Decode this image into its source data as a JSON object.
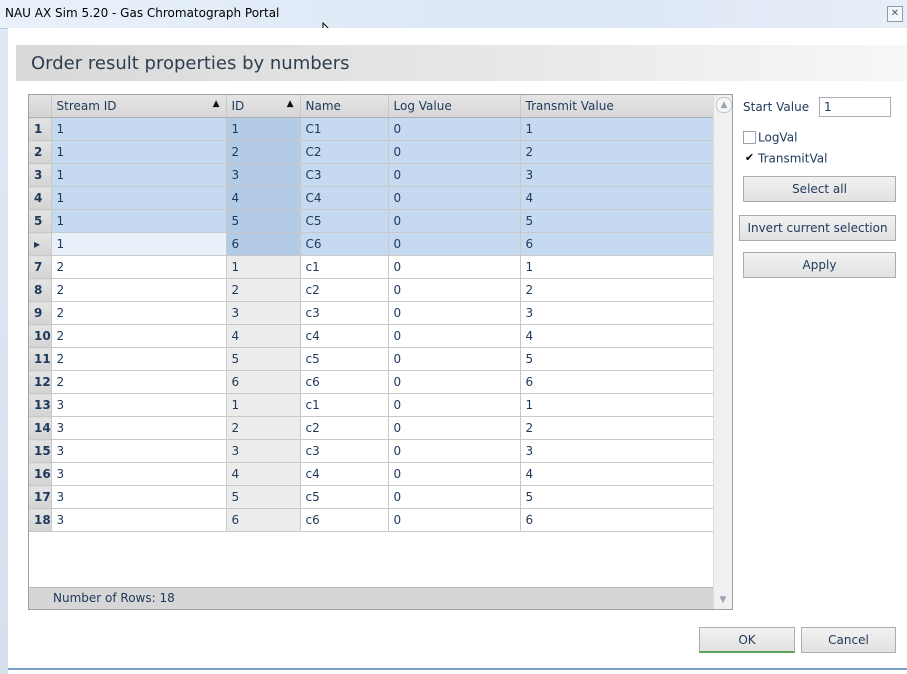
{
  "window": {
    "title": "NAU AX Sim 5.20 - Gas Chromatograph Portal",
    "close_glyph": "✕"
  },
  "dialog": {
    "heading": "Order result properties by numbers"
  },
  "grid": {
    "columns": [
      "Stream ID",
      "ID",
      "Name",
      "Log Value",
      "Transmit Value"
    ],
    "sort_glyph": "▲",
    "current_row_glyph": "▸",
    "rows": [
      {
        "num": "1",
        "stream": "1",
        "id": "1",
        "name": "C1",
        "log": "0",
        "transmit": "1",
        "selected": true
      },
      {
        "num": "2",
        "stream": "1",
        "id": "2",
        "name": "C2",
        "log": "0",
        "transmit": "2",
        "selected": true
      },
      {
        "num": "3",
        "stream": "1",
        "id": "3",
        "name": "C3",
        "log": "0",
        "transmit": "3",
        "selected": true
      },
      {
        "num": "4",
        "stream": "1",
        "id": "4",
        "name": "C4",
        "log": "0",
        "transmit": "4",
        "selected": true
      },
      {
        "num": "5",
        "stream": "1",
        "id": "5",
        "name": "C5",
        "log": "0",
        "transmit": "5",
        "selected": true
      },
      {
        "num": "",
        "stream": "1",
        "id": "6",
        "name": "C6",
        "log": "0",
        "transmit": "6",
        "selected": true,
        "current": true
      },
      {
        "num": "7",
        "stream": "2",
        "id": "1",
        "name": "c1",
        "log": "0",
        "transmit": "1"
      },
      {
        "num": "8",
        "stream": "2",
        "id": "2",
        "name": "c2",
        "log": "0",
        "transmit": "2"
      },
      {
        "num": "9",
        "stream": "2",
        "id": "3",
        "name": "c3",
        "log": "0",
        "transmit": "3"
      },
      {
        "num": "10",
        "stream": "2",
        "id": "4",
        "name": "c4",
        "log": "0",
        "transmit": "4"
      },
      {
        "num": "11",
        "stream": "2",
        "id": "5",
        "name": "c5",
        "log": "0",
        "transmit": "5"
      },
      {
        "num": "12",
        "stream": "2",
        "id": "6",
        "name": "c6",
        "log": "0",
        "transmit": "6"
      },
      {
        "num": "13",
        "stream": "3",
        "id": "1",
        "name": "c1",
        "log": "0",
        "transmit": "1"
      },
      {
        "num": "14",
        "stream": "3",
        "id": "2",
        "name": "c2",
        "log": "0",
        "transmit": "2"
      },
      {
        "num": "15",
        "stream": "3",
        "id": "3",
        "name": "c3",
        "log": "0",
        "transmit": "3"
      },
      {
        "num": "16",
        "stream": "3",
        "id": "4",
        "name": "c4",
        "log": "0",
        "transmit": "4"
      },
      {
        "num": "17",
        "stream": "3",
        "id": "5",
        "name": "c5",
        "log": "0",
        "transmit": "5"
      },
      {
        "num": "18",
        "stream": "3",
        "id": "6",
        "name": "c6",
        "log": "0",
        "transmit": "6"
      }
    ],
    "footer": "Number of Rows: 18"
  },
  "panel": {
    "start_label": "Start Value",
    "start_value": "1",
    "logval_label": "LogVal",
    "logval_checked": false,
    "transmitval_label": "TransmitVal",
    "transmitval_checked": true,
    "check_glyph": "✔",
    "select_all": "Select all",
    "invert": "Invert current selection",
    "apply": "Apply"
  },
  "buttons": {
    "ok": "OK",
    "cancel": "Cancel"
  },
  "colors": {
    "selection": "#c5d9f1",
    "text": "#1e395b"
  }
}
